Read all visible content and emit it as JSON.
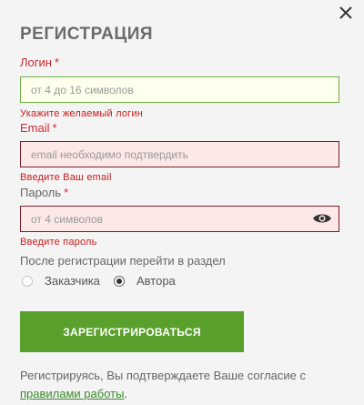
{
  "dialog": {
    "title": "РЕГИСТРАЦИЯ",
    "close_icon": "close-icon"
  },
  "login": {
    "label": "Логин",
    "required_mark": "*",
    "placeholder": "от 4 до 16 символов",
    "value": "",
    "error": "Укажите желаемый логин"
  },
  "email": {
    "label": "Email",
    "required_mark": "*",
    "placeholder": "email необходимо подтвердить",
    "value": "",
    "error": "Введите Ваш email"
  },
  "password": {
    "label": "Пароль",
    "required_mark": "*",
    "placeholder": "от 4 символов",
    "value": "",
    "error": "Введите пароль",
    "toggle_icon": "eye-icon"
  },
  "role": {
    "hint": "После регистрации перейти в раздел",
    "options": [
      {
        "label": "Заказчика",
        "selected": false
      },
      {
        "label": "Автора",
        "selected": true
      }
    ]
  },
  "submit_label": "ЗАРЕГИСТРИРОВАТЬСЯ",
  "consent": {
    "text": "Регистрируясь, Вы подтверждаете Ваше согласие с",
    "link": "правилами работы",
    "suffix": "."
  },
  "colors": {
    "accent_green": "#5aa02c",
    "error_red": "#cc1a1a",
    "field_error_border": "#7a1e26",
    "field_ok_border": "#6cb043"
  }
}
